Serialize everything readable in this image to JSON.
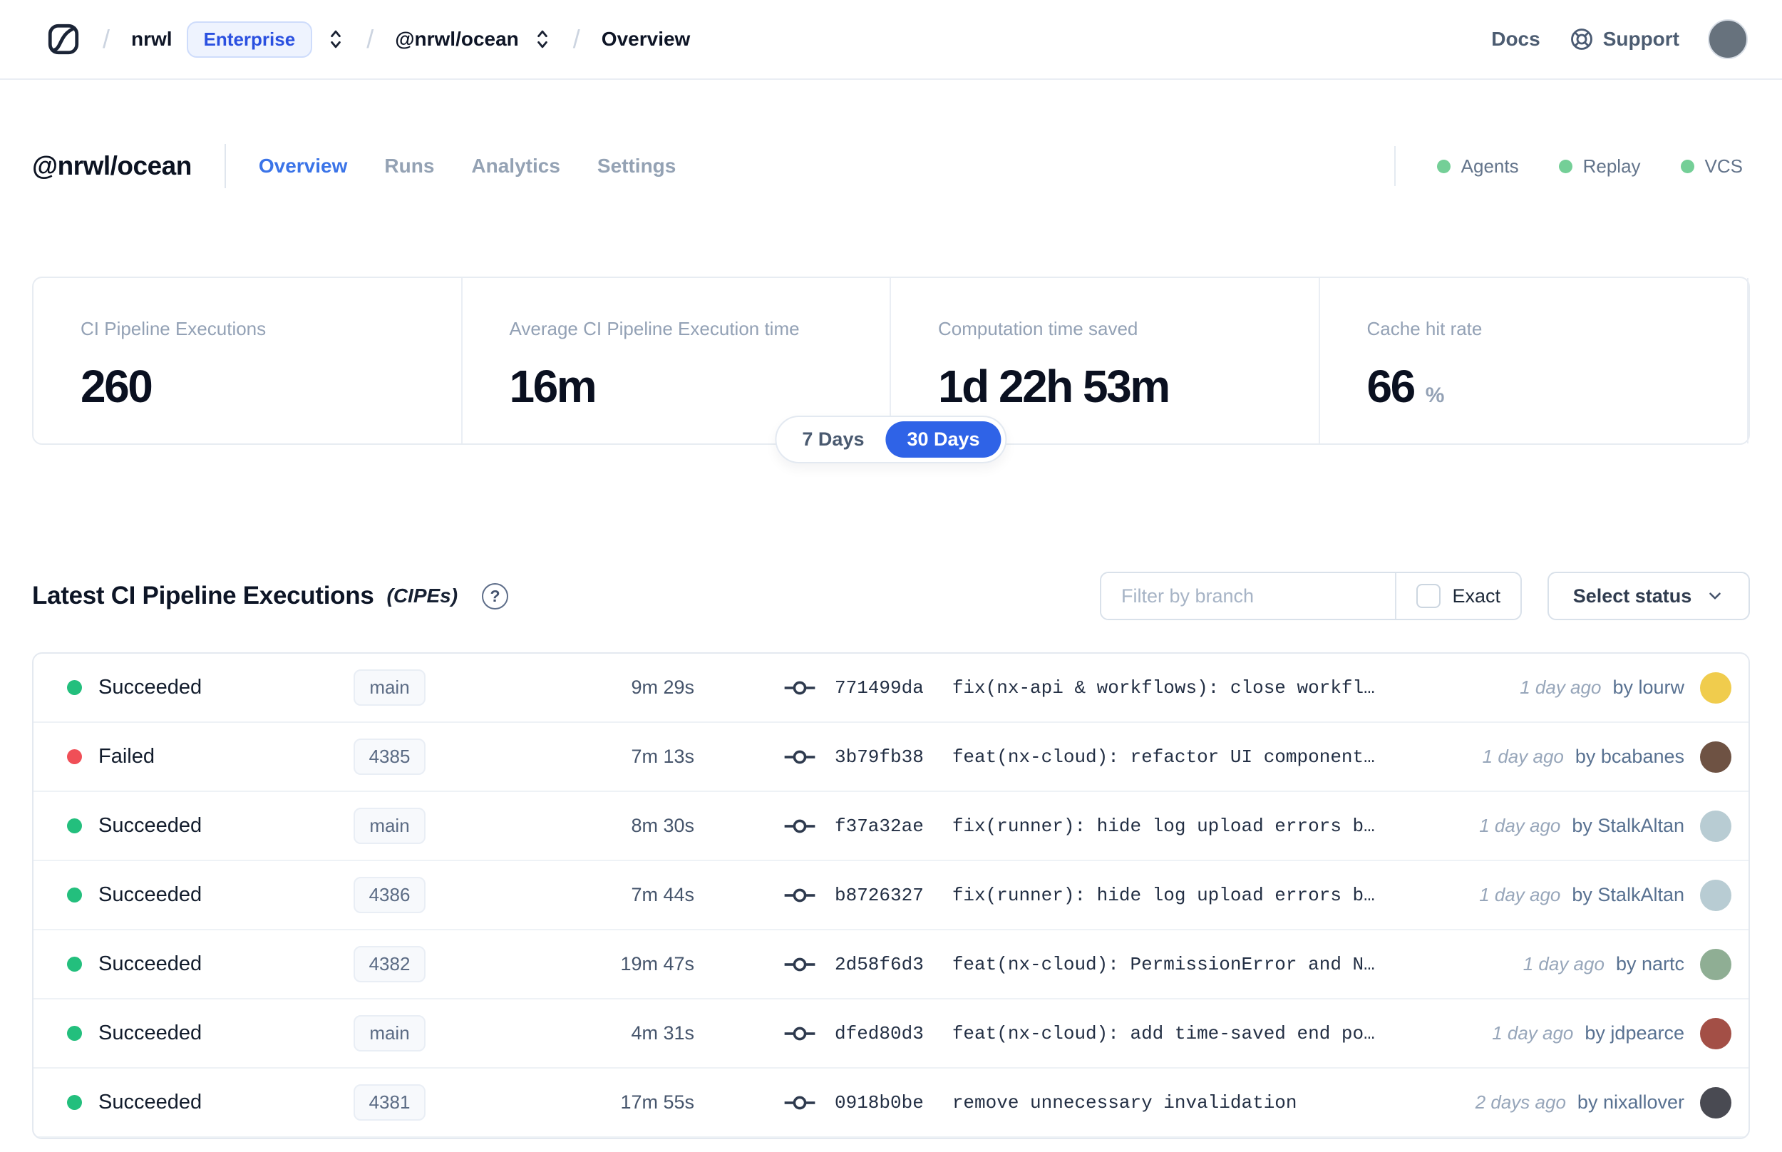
{
  "nav": {
    "breadcrumb": {
      "separator": "/",
      "org": "nrwl",
      "org_badge": "Enterprise",
      "workspace": "@nrwl/ocean",
      "page": "Overview"
    },
    "docs_label": "Docs",
    "support_label": "Support",
    "avatar_color": "#67727d"
  },
  "header": {
    "title": "@nrwl/ocean",
    "tabs": [
      {
        "label": "Overview",
        "active": true
      },
      {
        "label": "Runs",
        "active": false
      },
      {
        "label": "Analytics",
        "active": false
      },
      {
        "label": "Settings",
        "active": false
      }
    ],
    "indicators": [
      {
        "label": "Agents",
        "color": "#74cf97"
      },
      {
        "label": "Replay",
        "color": "#74cf97"
      },
      {
        "label": "VCS",
        "color": "#74cf97"
      }
    ]
  },
  "stats": {
    "cards": [
      {
        "label": "CI Pipeline Executions",
        "value": "260",
        "suffix": ""
      },
      {
        "label": "Average CI Pipeline Execution time",
        "value": "16m",
        "suffix": ""
      },
      {
        "label": "Computation time saved",
        "value": "1d 22h 53m",
        "suffix": ""
      },
      {
        "label": "Cache hit rate",
        "value": "66",
        "suffix": "%"
      }
    ],
    "range": {
      "options": [
        "7 Days",
        "30 Days"
      ],
      "selected": "30 Days"
    }
  },
  "section": {
    "title": "Latest CI Pipeline Executions",
    "subtitle": "(CIPEs)",
    "help_glyph": "?",
    "filter": {
      "placeholder": "Filter by branch",
      "exact_label": "Exact"
    },
    "status_select": {
      "label": "Select status"
    }
  },
  "table": {
    "rows": [
      {
        "status": "Succeeded",
        "dot_color": "#23bf7d",
        "branch": "main",
        "duration": "9m 29s",
        "commit_hash": "771499da",
        "commit_message": "fix(nx-api & workflows): close workfl…",
        "time_ago": "1 day ago",
        "author": "by lourw",
        "avatar_color": "#f0cc4d"
      },
      {
        "status": "Failed",
        "dot_color": "#f04f57",
        "branch": "4385",
        "duration": "7m 13s",
        "commit_hash": "3b79fb38",
        "commit_message": "feat(nx-cloud): refactor UI component…",
        "time_ago": "1 day ago",
        "author": "by bcabanes",
        "avatar_color": "#6e5243"
      },
      {
        "status": "Succeeded",
        "dot_color": "#23bf7d",
        "branch": "main",
        "duration": "8m 30s",
        "commit_hash": "f37a32ae",
        "commit_message": "fix(runner): hide log upload errors b…",
        "time_ago": "1 day ago",
        "author": "by StalkAltan",
        "avatar_color": "#b8ccd3"
      },
      {
        "status": "Succeeded",
        "dot_color": "#23bf7d",
        "branch": "4386",
        "duration": "7m 44s",
        "commit_hash": "b8726327",
        "commit_message": "fix(runner): hide log upload errors b…",
        "time_ago": "1 day ago",
        "author": "by StalkAltan",
        "avatar_color": "#b8ccd3"
      },
      {
        "status": "Succeeded",
        "dot_color": "#23bf7d",
        "branch": "4382",
        "duration": "19m 47s",
        "commit_hash": "2d58f6d3",
        "commit_message": "feat(nx-cloud): PermissionError and N…",
        "time_ago": "1 day ago",
        "author": "by nartc",
        "avatar_color": "#8fae94"
      },
      {
        "status": "Succeeded",
        "dot_color": "#23bf7d",
        "branch": "main",
        "duration": "4m 31s",
        "commit_hash": "dfed80d3",
        "commit_message": "feat(nx-cloud): add time-saved end po…",
        "time_ago": "1 day ago",
        "author": "by jdpearce",
        "avatar_color": "#a34f46"
      },
      {
        "status": "Succeeded",
        "dot_color": "#23bf7d",
        "branch": "4381",
        "duration": "17m 55s",
        "commit_hash": "0918b0be",
        "commit_message": "remove unnecessary invalidation",
        "time_ago": "2 days ago",
        "author": "by nixallover",
        "avatar_color": "#494a52"
      }
    ]
  },
  "colors": {
    "accent_blue": "#2f63e7",
    "active_tab_blue": "#3b74e8",
    "success_green": "#23bf7d",
    "failed_red": "#f04f57",
    "indicator_green": "#74cf97",
    "enterprise_blue": "#2a50e0"
  }
}
